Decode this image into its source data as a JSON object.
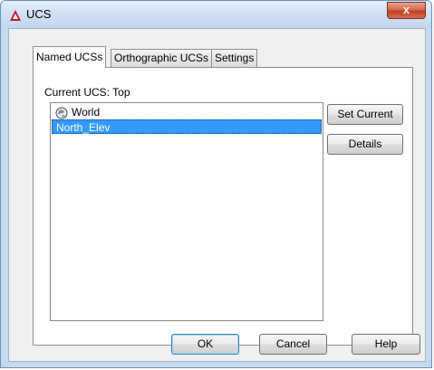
{
  "window": {
    "title": "UCS",
    "close_glyph": "x"
  },
  "tabs": [
    {
      "label": "Named UCSs",
      "active": true
    },
    {
      "label": "Orthographic UCSs",
      "active": false
    },
    {
      "label": "Settings",
      "active": false
    }
  ],
  "current_ucs": {
    "label": "Current UCS:",
    "value": "Top"
  },
  "list": {
    "items": [
      {
        "label": "World",
        "icon": "globe-icon",
        "selected": false
      },
      {
        "label": "North_Elev",
        "icon": "",
        "selected": true
      }
    ]
  },
  "side_buttons": {
    "set_current": "Set Current",
    "details": "Details"
  },
  "footer": {
    "ok": "OK",
    "cancel": "Cancel",
    "help": "Help"
  },
  "colors": {
    "selection": "#3399ff",
    "close_button": "#c13f22",
    "titlebar": "#cddff3"
  }
}
